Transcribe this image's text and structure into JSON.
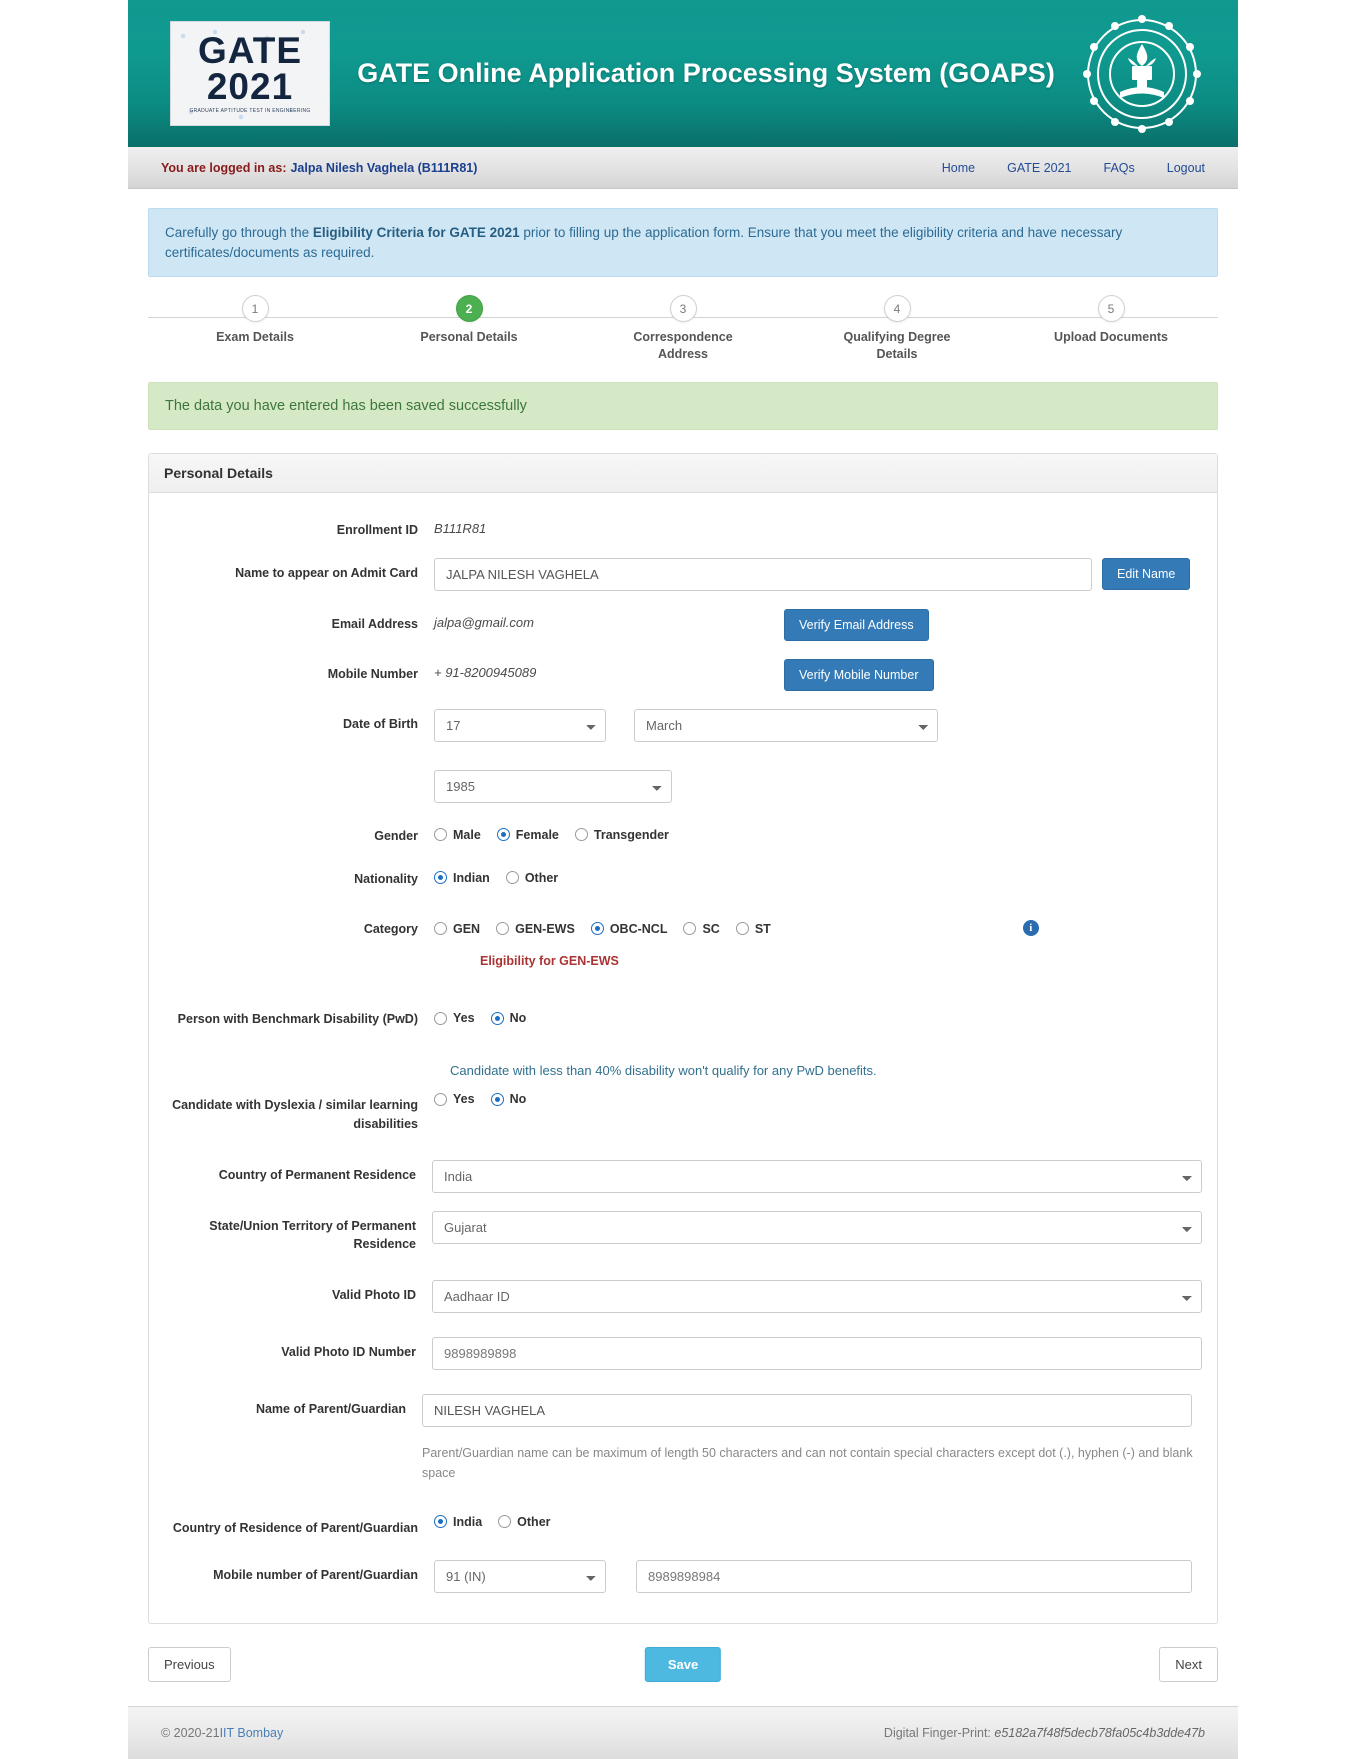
{
  "header": {
    "logo": {
      "line1": "GATE",
      "line2": "2021",
      "tagline": "GRADUATE APTITUDE TEST IN ENGINEERING"
    },
    "title": "GATE Online Application Processing System (GOAPS)",
    "seal_name": "iit-bombay-seal"
  },
  "loginbar": {
    "prefix": "You are logged in as:",
    "user": "Jalpa Nilesh Vaghela (B111R81)",
    "links": [
      {
        "label": "Home"
      },
      {
        "label": "GATE 2021"
      },
      {
        "label": "FAQs"
      },
      {
        "label": "Logout"
      }
    ]
  },
  "notice": {
    "part1": "Carefully go through the ",
    "emphasis": "Eligibility Criteria for GATE 2021",
    "part2": " prior to filling up the application form. Ensure that you meet the eligibility criteria and have necessary certificates/documents as required."
  },
  "stepper": {
    "active_index": 1,
    "steps": [
      {
        "num": "1",
        "label": "Exam Details"
      },
      {
        "num": "2",
        "label": "Personal Details"
      },
      {
        "num": "3",
        "label": "Correspondence Address"
      },
      {
        "num": "4",
        "label": "Qualifying Degree Details"
      },
      {
        "num": "5",
        "label": "Upload Documents"
      }
    ]
  },
  "success_message": "The data you have entered has been saved successfully",
  "panel": {
    "title": "Personal Details",
    "fields": {
      "enrollment_id": {
        "label": "Enrollment ID",
        "value": "B111R81"
      },
      "admit_name": {
        "label": "Name to appear on Admit Card",
        "value": "JALPA NILESH VAGHELA",
        "button": "Edit Name"
      },
      "email": {
        "label": "Email Address",
        "value": "jalpa@gmail.com",
        "button": "Verify Email Address"
      },
      "mobile": {
        "label": "Mobile Number",
        "value": "+ 91-8200945089",
        "button": "Verify Mobile Number"
      },
      "dob": {
        "label": "Date of Birth",
        "day": "17",
        "month": "March",
        "year": "1985"
      },
      "gender": {
        "label": "Gender",
        "options": [
          "Male",
          "Female",
          "Transgender"
        ],
        "selected": "Female"
      },
      "nationality": {
        "label": "Nationality",
        "options": [
          "Indian",
          "Other"
        ],
        "selected": "Indian"
      },
      "category": {
        "label": "Category",
        "options": [
          "GEN",
          "GEN-EWS",
          "OBC-NCL",
          "SC",
          "ST"
        ],
        "selected": "OBC-NCL",
        "info_icon": "info-circle-icon",
        "eligibility_link": "Eligibility for GEN-EWS"
      },
      "pwd": {
        "label": "Person with Benchmark Disability (PwD)",
        "options": [
          "Yes",
          "No"
        ],
        "selected": "No",
        "help": "Candidate with less than 40% disability won't qualify for any PwD benefits."
      },
      "dyslexia": {
        "label": "Candidate with Dyslexia / similar learning disabilities",
        "options": [
          "Yes",
          "No"
        ],
        "selected": "No"
      },
      "country_residence": {
        "label": "Country of Permanent Residence",
        "value": "India"
      },
      "state_residence": {
        "label": "State/Union Territory of Permanent Residence",
        "value": "Gujarat"
      },
      "photo_id_type": {
        "label": "Valid Photo ID",
        "value": "Aadhaar ID"
      },
      "photo_id_number": {
        "label": "Valid Photo ID Number",
        "value": "9898989898"
      },
      "parent_name": {
        "label": "Name of Parent/Guardian",
        "value": "NILESH VAGHELA",
        "help": "Parent/Guardian name can be maximum of length 50 characters and can not contain special characters except dot (.), hyphen (-) and blank space"
      },
      "parent_country": {
        "label": "Country of Residence of Parent/Guardian",
        "options": [
          "India",
          "Other"
        ],
        "selected": "India"
      },
      "parent_mobile": {
        "label": "Mobile number of Parent/Guardian",
        "code": "91 (IN)",
        "value": "8989898984"
      }
    }
  },
  "nav": {
    "previous": "Previous",
    "save": "Save",
    "next": "Next"
  },
  "footer": {
    "copyright_prefix": "© 2020-21 ",
    "copyright_link": "IIT Bombay",
    "fingerprint_label": "Digital Finger-Print: ",
    "fingerprint_value": "e5182a7f48f5decb78fa05c4b3dde47b"
  },
  "colors": {
    "banner_teal": "#0f9a90",
    "accent_blue": "#337ab7",
    "save_blue": "#4db8e0",
    "step_green": "#4caf50",
    "success_green": "#d6e9c6",
    "notice_blue": "#cfe7f5"
  }
}
